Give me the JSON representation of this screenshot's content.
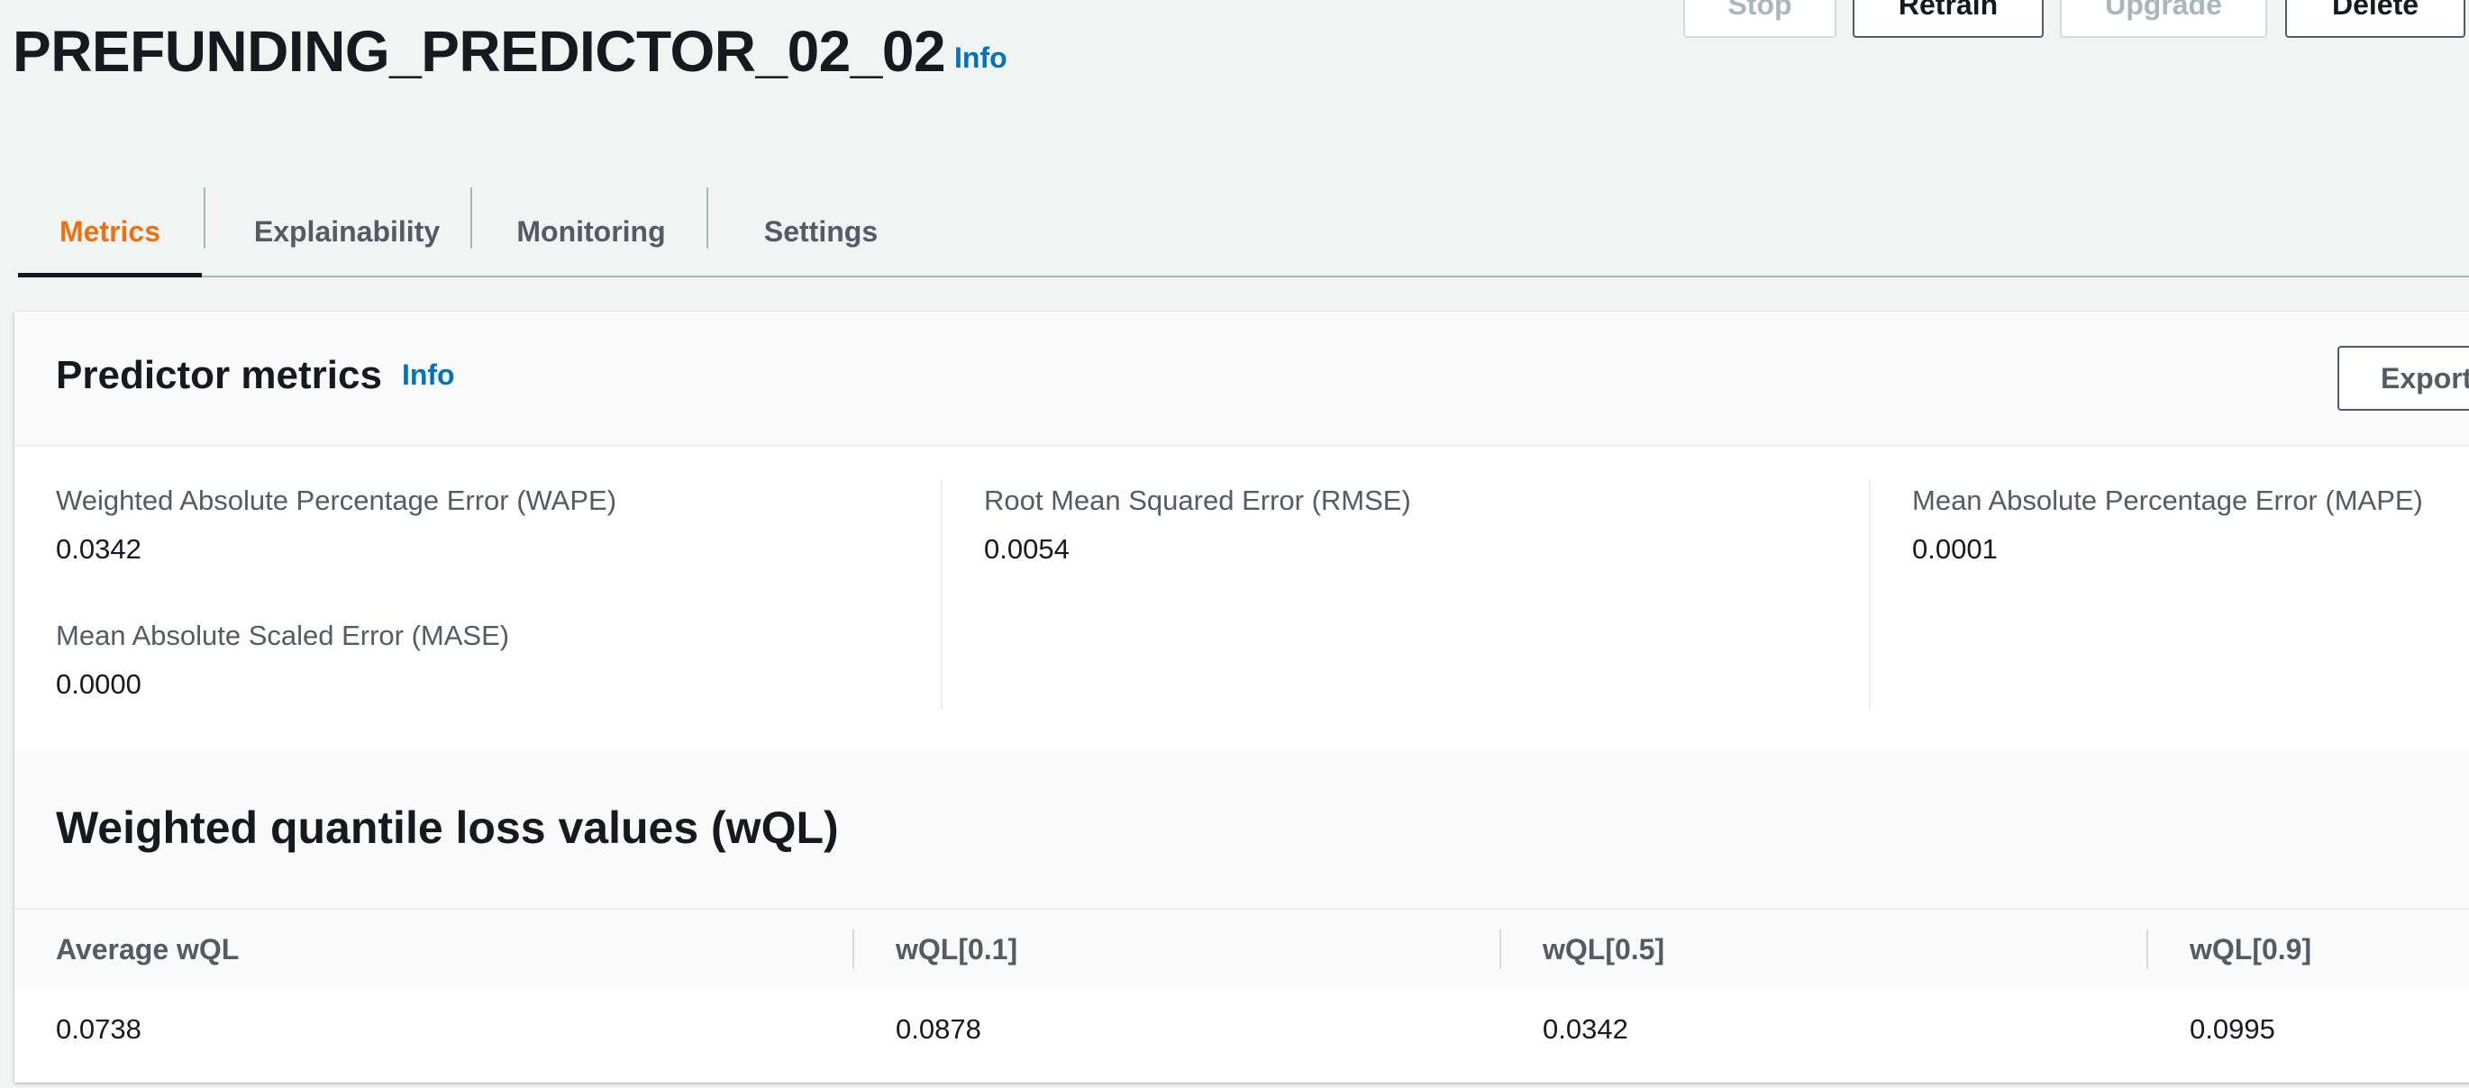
{
  "header": {
    "title": "PREFUNDING_PREDICTOR_02_02",
    "info_label": "Info",
    "actions": {
      "stop": "Stop",
      "retrain": "Retrain",
      "upgrade": "Upgrade",
      "delete": "Delete"
    }
  },
  "tabs": [
    {
      "label": "Metrics",
      "active": true
    },
    {
      "label": "Explainability",
      "active": false
    },
    {
      "label": "Monitoring",
      "active": false
    },
    {
      "label": "Settings",
      "active": false
    }
  ],
  "predictor_metrics": {
    "title": "Predictor metrics",
    "info_label": "Info",
    "export_label": "Export",
    "metrics": [
      {
        "label": "Weighted Absolute Percentage Error (WAPE)",
        "value": "0.0342"
      },
      {
        "label": "Root Mean Squared Error (RMSE)",
        "value": "0.0054"
      },
      {
        "label": "Mean Absolute Percentage Error (MAPE)",
        "value": "0.0001"
      },
      {
        "label": "Mean Absolute Scaled Error (MASE)",
        "value": "0.0000"
      }
    ]
  },
  "wql": {
    "title": "Weighted quantile loss values (wQL)",
    "columns": [
      "Average wQL",
      "wQL[0.1]",
      "wQL[0.5]",
      "wQL[0.9]"
    ],
    "values": [
      "0.0738",
      "0.0878",
      "0.0342",
      "0.0995"
    ]
  },
  "colors": {
    "accent_orange": "#ec7211",
    "link_blue": "#0073bb",
    "text_dark": "#16191f",
    "text_secondary": "#545b64",
    "disabled": "#aab7b8"
  }
}
